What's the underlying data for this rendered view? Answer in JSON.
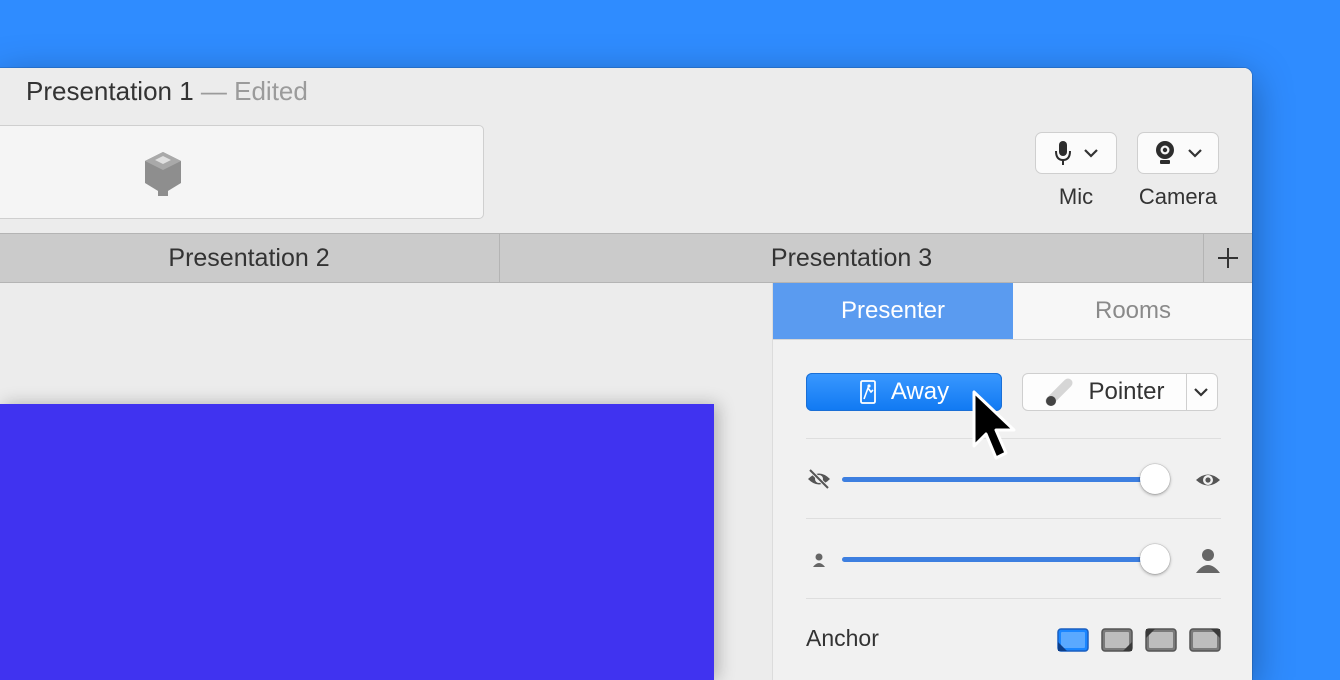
{
  "window": {
    "title": "Presentation 1",
    "edited_suffix": " — Edited"
  },
  "toolbar": {
    "mic_label": "Mic",
    "camera_label": "Camera"
  },
  "tabs": [
    {
      "label": "Presentation 2"
    },
    {
      "label": "Presentation 3"
    }
  ],
  "tab_add_label": "+",
  "sidebar": {
    "segments": [
      {
        "label": "Presenter",
        "selected": true
      },
      {
        "label": "Rooms",
        "selected": false
      }
    ],
    "away_label": "Away",
    "pointer_label": "Pointer",
    "visibility_slider": {
      "value": 1.0
    },
    "size_slider": {
      "value": 1.0
    },
    "anchor_label": "Anchor",
    "anchor_selected_index": 0
  },
  "colors": {
    "background": "#2f8cff",
    "slide": "#4033f0",
    "accent": "#5a9bf0",
    "button_blue": "#1079f2"
  },
  "icons": [
    "app-logo-icon",
    "mic-icon",
    "camera-icon",
    "chevron-down-icon",
    "plus-icon",
    "away-icon",
    "pointer-icon",
    "eye-slash-icon",
    "eye-icon",
    "person-small-icon",
    "person-large-icon",
    "anchor-bottom-left-icon",
    "anchor-bottom-right-icon",
    "anchor-top-left-icon",
    "anchor-top-right-icon",
    "mouse-cursor-icon"
  ]
}
